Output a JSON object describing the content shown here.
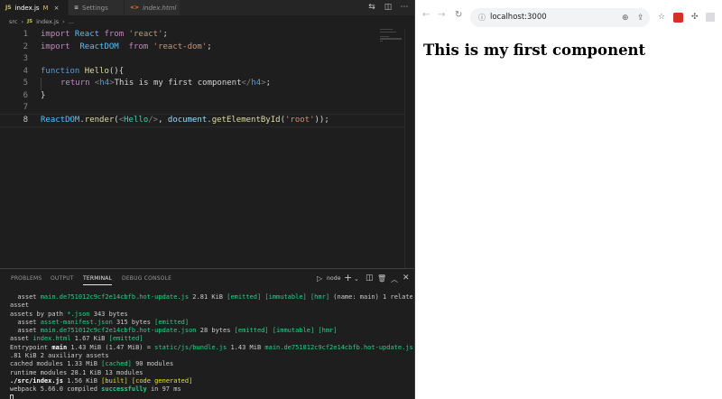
{
  "editor": {
    "tabs": [
      {
        "icon": "JS",
        "label": "index.js",
        "modified": "M",
        "close": "×"
      },
      {
        "icon": "≡",
        "label": "Settings"
      },
      {
        "icon": "<>",
        "label": "index.html"
      }
    ],
    "breadcrumb": {
      "folder": "src",
      "sep": "›",
      "icon": "JS",
      "file": "index.js",
      "symbol": "..."
    },
    "line_numbers": [
      "1",
      "2",
      "3",
      "4",
      "5",
      "6",
      "7",
      "8"
    ],
    "code": {
      "l1": {
        "kw": "import",
        "name": " React ",
        "from": "from",
        "str": " 'react'",
        "end": ";"
      },
      "l2": {
        "kw": "import",
        "name": "  ReactDOM  ",
        "from": "from",
        "str": " 'react-dom'",
        "end": ";"
      },
      "l4": {
        "kw": "function",
        "fn": " Hello",
        "end": "(){"
      },
      "l5": {
        "kw": "return",
        "open": " <",
        "tag": "h4",
        "open2": ">",
        "text": "This is my first component",
        "close": "</",
        "ctag": "h4",
        "close2": ">",
        "end": ";"
      },
      "l6": {
        "end": "}"
      },
      "l8": {
        "obj": "ReactDOM",
        "dot": ".",
        "fn": "render",
        "p1": "(",
        "lt": "<",
        "cls": "Hello",
        "sl": "/>",
        "comma": ", ",
        "doc": "document",
        "dot2": ".",
        "fn2": "getElementById",
        "p2": "(",
        "str": "'root'",
        "end": "));"
      }
    }
  },
  "panel": {
    "tabs": [
      "PROBLEMS",
      "OUTPUT",
      "TERMINAL",
      "DEBUG CONSOLE"
    ],
    "shell": "node",
    "terminal": {
      "l1": {
        "a": "  asset ",
        "b": "main.de751012c9cf2e14cbfb.hot-update.js",
        "c": " 2.81 KiB ",
        "d": "[emitted] [immutable] [hmr]",
        "e": " (name: main) 1 related"
      },
      "l2": {
        "a": "asset"
      },
      "l3": {
        "a": "assets by path ",
        "b": "*.json",
        "c": " 343 bytes"
      },
      "l4": {
        "a": "  asset ",
        "b": "asset-manifest.json",
        "c": " 315 bytes ",
        "d": "[emitted]"
      },
      "l5": {
        "a": "  asset ",
        "b": "main.de751012c9cf2e14cbfb.hot-update.json",
        "c": " 28 bytes ",
        "d": "[emitted] [immutable] [hmr]"
      },
      "l6": {
        "a": "asset ",
        "b": "index.html",
        "c": " 1.67 KiB ",
        "d": "[emitted]"
      },
      "l7": {
        "a": "Entrypoint ",
        "b": "main",
        "c": " 1.43 MiB (1.47 MiB) = ",
        "d": "static/js/bundle.js",
        "e": " 1.43 MiB ",
        "f": "main.de751012c9cf2e14cbfb.hot-update.js",
        "g": " 2"
      },
      "l8": {
        "a": ".81 KiB 2 auxiliary assets"
      },
      "l9": {
        "a": "cached modules 1.33 MiB ",
        "b": "[cached]",
        "c": " 90 modules"
      },
      "l10": {
        "a": "runtime modules 28.1 KiB 13 modules"
      },
      "l11": {
        "a": "./src/index.js",
        "b": " 1.56 KiB ",
        "c": "[built] [code generated]"
      },
      "l12": {
        "a": "webpack 5.66.0 compiled ",
        "b": "successfully",
        "c": " in 97 ms"
      }
    }
  },
  "browser": {
    "url": "localhost:3000",
    "heading": "This is my first component"
  },
  "colors": {
    "accent_green": "#23d18b",
    "accent_yellow": "#e5e510",
    "editor_bg": "#1e1e1e"
  }
}
